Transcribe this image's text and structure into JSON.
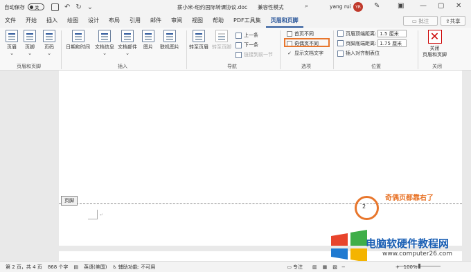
{
  "titlebar": {
    "autosave_label": "自动保存",
    "autosave_state": "关",
    "doc_title": "薪小米-纽约国际转课协议.doc",
    "mode": "兼容性模式",
    "user_name": "yang rui",
    "avatar_initials": "YR"
  },
  "tabs": [
    "文件",
    "开始",
    "插入",
    "绘图",
    "设计",
    "布局",
    "引用",
    "邮件",
    "审阅",
    "视图",
    "帮助",
    "PDF工具集",
    "页眉和页脚"
  ],
  "active_tab": "页眉和页脚",
  "comment_label": "批注",
  "share_label": "共享",
  "ribbon": {
    "header_footer": {
      "items": [
        "页眉",
        "页脚",
        "页码"
      ],
      "group": "页眉和页脚"
    },
    "insert": {
      "items": [
        "日期和时间",
        "文档信息",
        "文档部件",
        "图片",
        "联机图片"
      ],
      "group": "插入"
    },
    "navigation": {
      "goto_header": "转至页眉",
      "goto_footer": "转至页脚",
      "prev": "上一条",
      "next": "下一条",
      "link_prev": "链接到前一节",
      "group": "导航"
    },
    "options": {
      "first_page": "首页不同",
      "odd_even": "奇偶页不同",
      "show_text": "显示文档文字",
      "group": "选项"
    },
    "position": {
      "header_top": "页眉顶端距离:",
      "header_top_value": "1.5 厘米",
      "footer_bottom": "页脚底端距离:",
      "footer_bottom_value": "1.75 厘米",
      "insert_align": "插入对齐制表位",
      "group": "位置"
    },
    "close": {
      "label1": "关闭",
      "label2": "页眉和页脚",
      "group": "关闭"
    }
  },
  "document": {
    "footer_tag": "页脚",
    "page_number": "2",
    "annotation": "奇偶页都靠右了"
  },
  "watermark": {
    "title": "电脑软硬件教程网",
    "url": "www.computer26.com"
  },
  "statusbar": {
    "page": "第 2 页，共 4 页",
    "words": "868 个字",
    "language": "英语(美国)",
    "accessibility": "辅助功能: 不可用",
    "focus": "专注",
    "zoom": "100%"
  }
}
